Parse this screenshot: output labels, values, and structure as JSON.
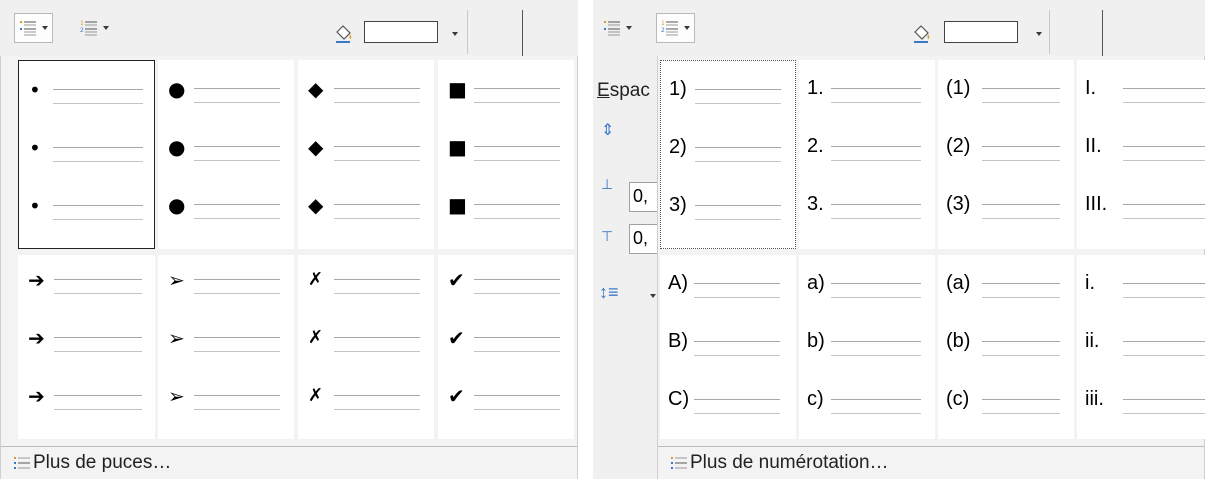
{
  "left_panel": {
    "more_label": "Plus de puces…",
    "bullet_grid": [
      [
        "•",
        "●",
        "◆",
        "■"
      ],
      [
        "➔",
        "➢",
        "✗",
        "✔"
      ]
    ]
  },
  "right_panel": {
    "more_label": "Plus de numérotation…",
    "sidebar_label_underlined": "E",
    "sidebar_label_rest": "spac",
    "spin_value": "0,",
    "number_grid": [
      [
        [
          "1)",
          "2)",
          "3)"
        ],
        [
          "1.",
          "2.",
          "3."
        ],
        [
          "(1)",
          "(2)",
          "(3)"
        ],
        [
          "I.",
          "II.",
          "III."
        ]
      ],
      [
        [
          "A)",
          "B)",
          "C)"
        ],
        [
          "a)",
          "b)",
          "c)"
        ],
        [
          "(a)",
          "(b)",
          "(c)"
        ],
        [
          "i.",
          "ii.",
          "iii."
        ]
      ]
    ]
  },
  "colors": {
    "accent_icon": "#d99a2b",
    "list_icon_blue": "#3c78c8"
  }
}
